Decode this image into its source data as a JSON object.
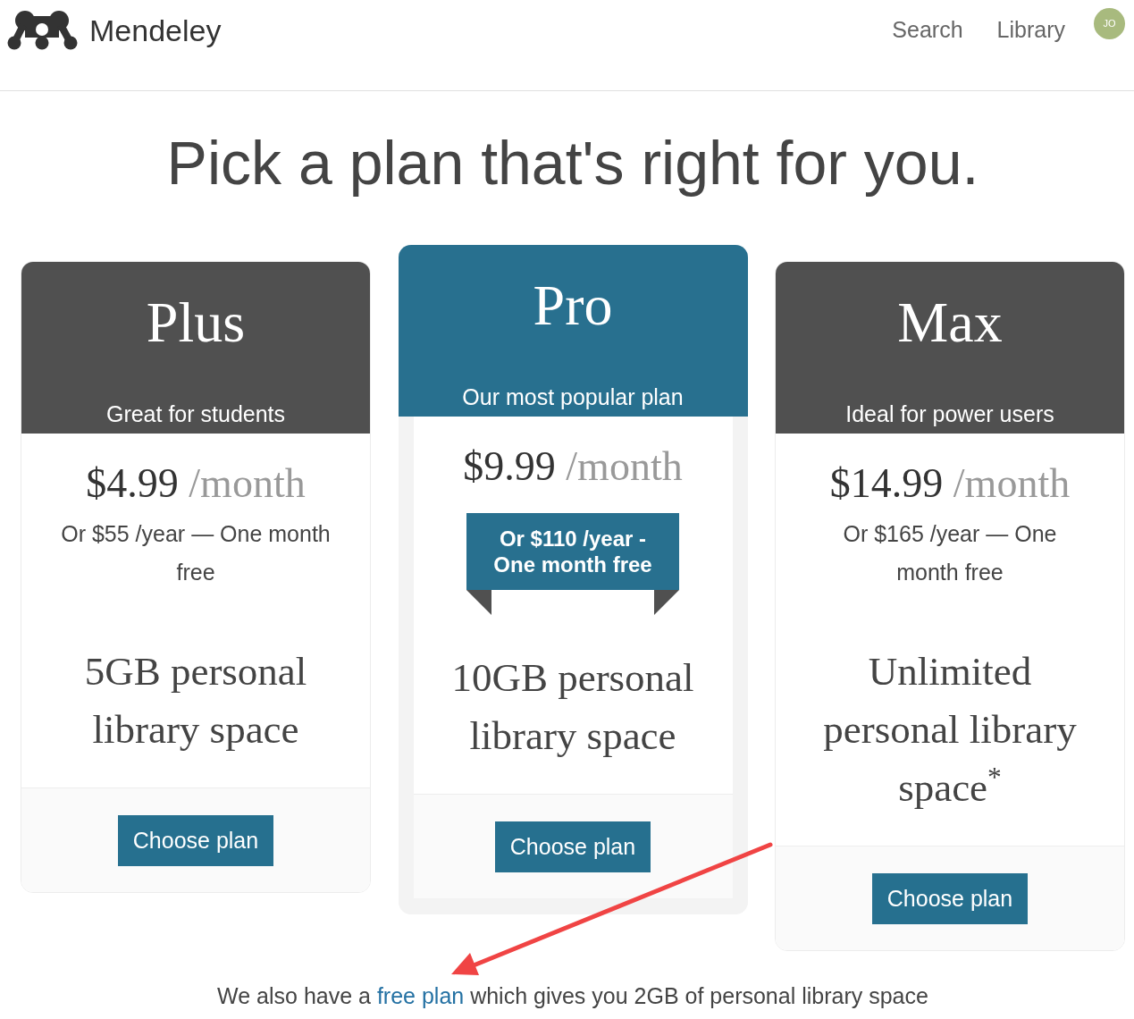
{
  "header": {
    "brand": "Mendeley",
    "nav": [
      {
        "label": "Search"
      },
      {
        "label": "Library"
      }
    ],
    "avatar": {
      "initials": "JO"
    }
  },
  "title": "Pick a plan that's right for you.",
  "plans": [
    {
      "name": "Plus",
      "tagline": "Great for students",
      "featured": false,
      "price": "$4.99",
      "period": "/month",
      "yearly": "Or $55 /year — One month free",
      "storage": "5GB personal library space",
      "button": "Choose plan"
    },
    {
      "name": "Pro",
      "tagline": "Our most popular plan",
      "featured": true,
      "price": "$9.99",
      "period": "/month",
      "yearly": "Or $110 /year - One month free",
      "storage": "10GB personal library space",
      "button": "Choose plan"
    },
    {
      "name": "Max",
      "tagline": "Ideal for power users",
      "featured": false,
      "price": "$14.99",
      "period": "/month",
      "yearly": "Or $165 /year — One month free",
      "storage": "Unlimited personal library space$^{*}$",
      "button": "Choose plan"
    }
  ],
  "note": {
    "before": "We also have a ",
    "link": "free plan",
    "after": " which gives you 2GB of personal library space"
  },
  "annotation": {
    "kind": "arrow"
  }
}
